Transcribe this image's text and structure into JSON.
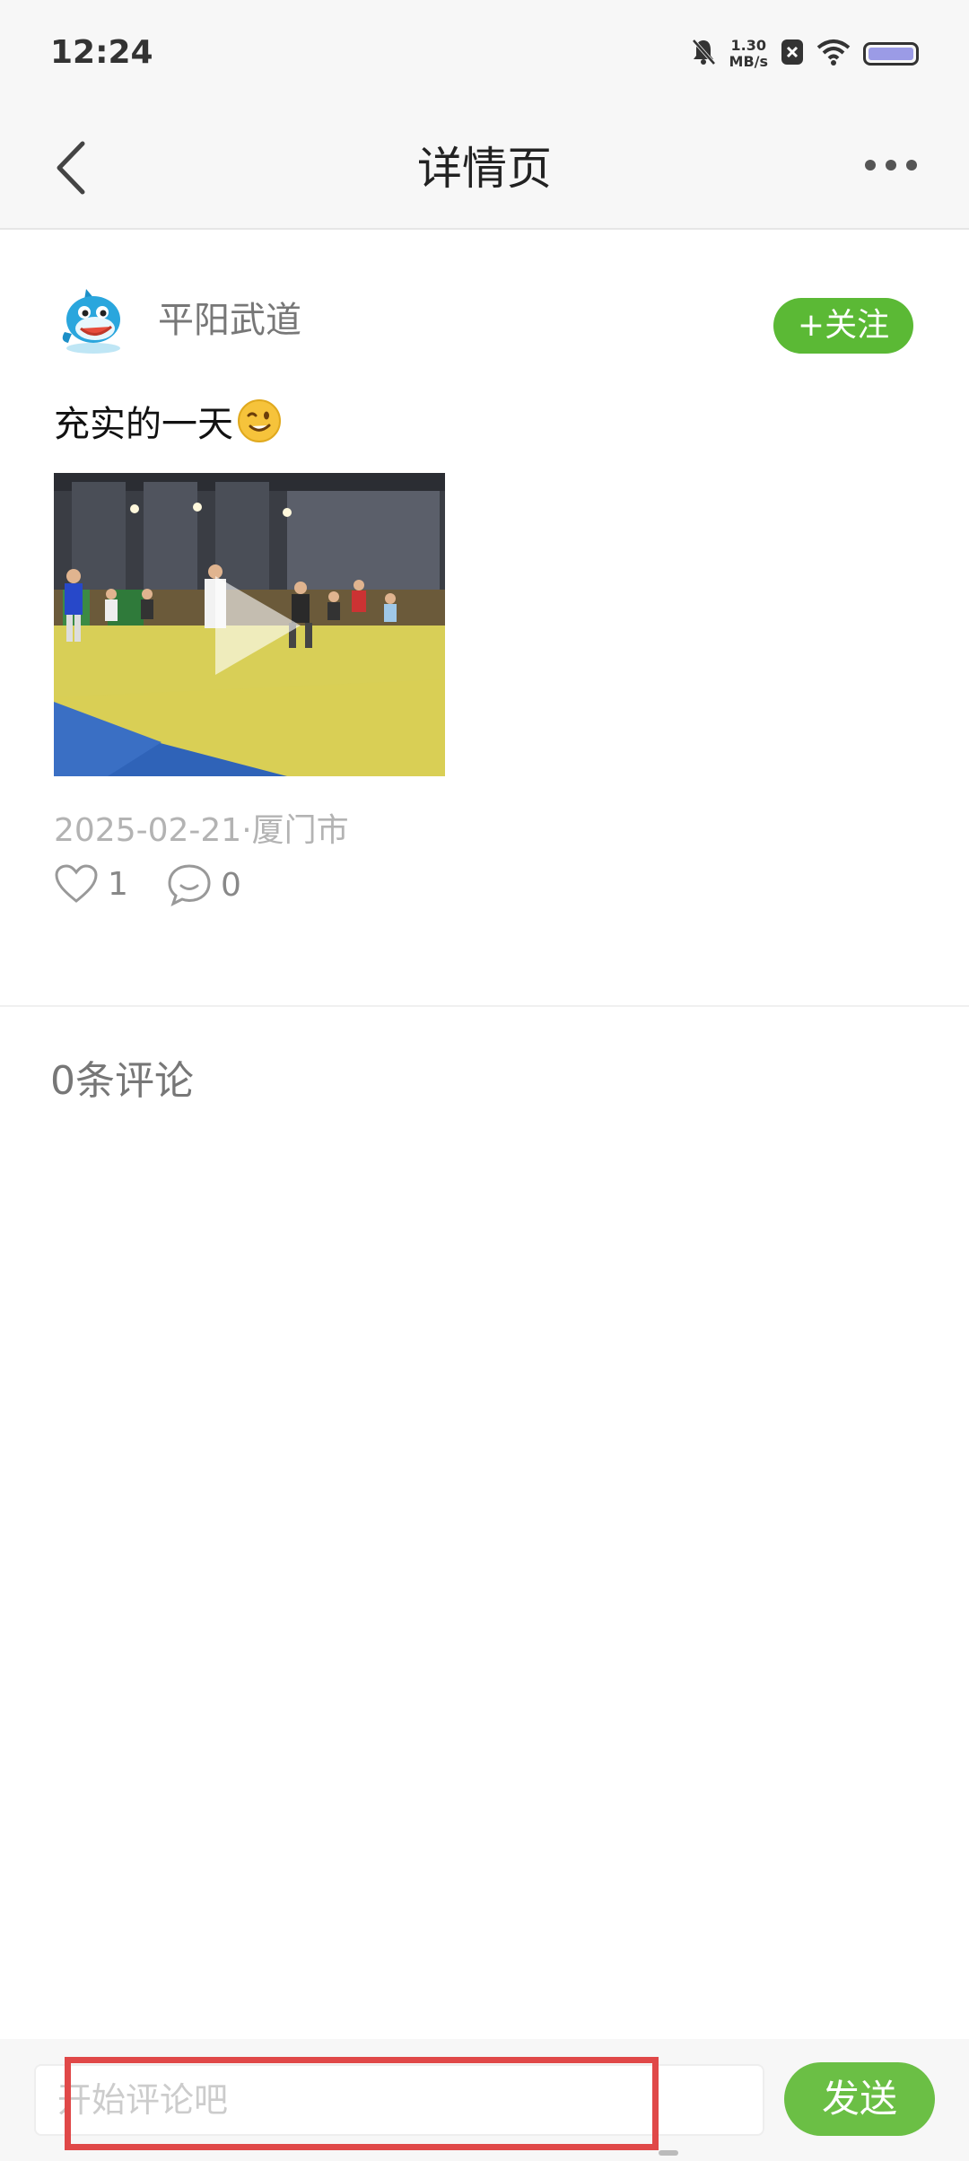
{
  "status_bar": {
    "time": "12:24",
    "net_speed_value": "1.30",
    "net_speed_unit": "MB/s",
    "icons": [
      "bell-off-icon",
      "close-box-icon",
      "wifi-icon",
      "battery-icon"
    ]
  },
  "header": {
    "title": "详情页",
    "back_icon": "chevron-left-icon",
    "more_icon": "more-horizontal-icon"
  },
  "post": {
    "author": "平阳武道",
    "follow_label": "+关注",
    "text": "充实的一天",
    "emoji": "wink-emoji",
    "date": "2025-02-21",
    "location": "厦门市",
    "likes": "1",
    "comments": "0",
    "media_type": "video"
  },
  "comments_section": {
    "count_label": "0条评论"
  },
  "comment_bar": {
    "placeholder": "开始评论吧",
    "value": "",
    "send_label": "发送"
  },
  "colors": {
    "accent_green": "#5bb935",
    "highlight_red": "#e04848",
    "header_bg": "#f7f7f7"
  }
}
